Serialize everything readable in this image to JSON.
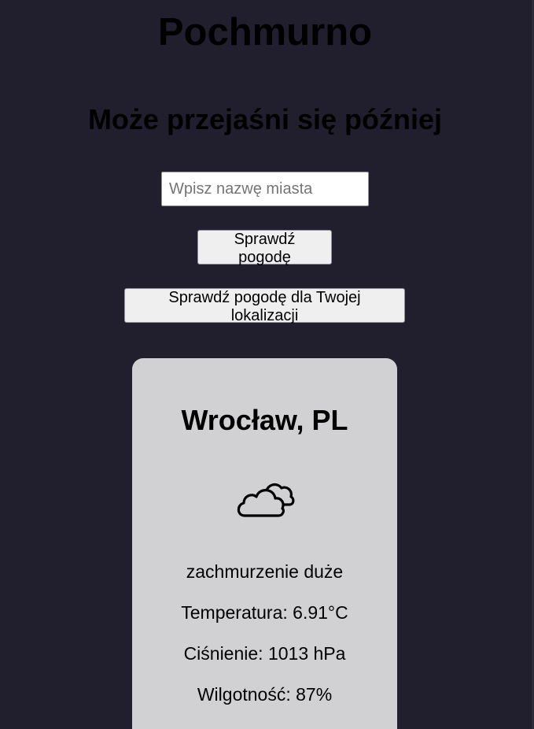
{
  "header": {
    "title": "Pochmurno",
    "subtitle": "Może przejaśni się później"
  },
  "search": {
    "placeholder": "Wpisz nazwę miasta",
    "value": "",
    "check_button_label": "Sprawdź pogodę",
    "location_button_label": "Sprawdź pogodę dla Twojej lokalizacji"
  },
  "weather": {
    "city": "Wrocław, PL",
    "icon": "cloudy-icon",
    "description": "zachmurzenie duże",
    "temperature": "Temperatura: 6.91°C",
    "pressure": "Ciśnienie: 1013 hPa",
    "humidity": "Wilgotność: 87%"
  },
  "colors": {
    "background": "#211e2d",
    "card": "#d1d1d3",
    "button": "#efefef"
  }
}
